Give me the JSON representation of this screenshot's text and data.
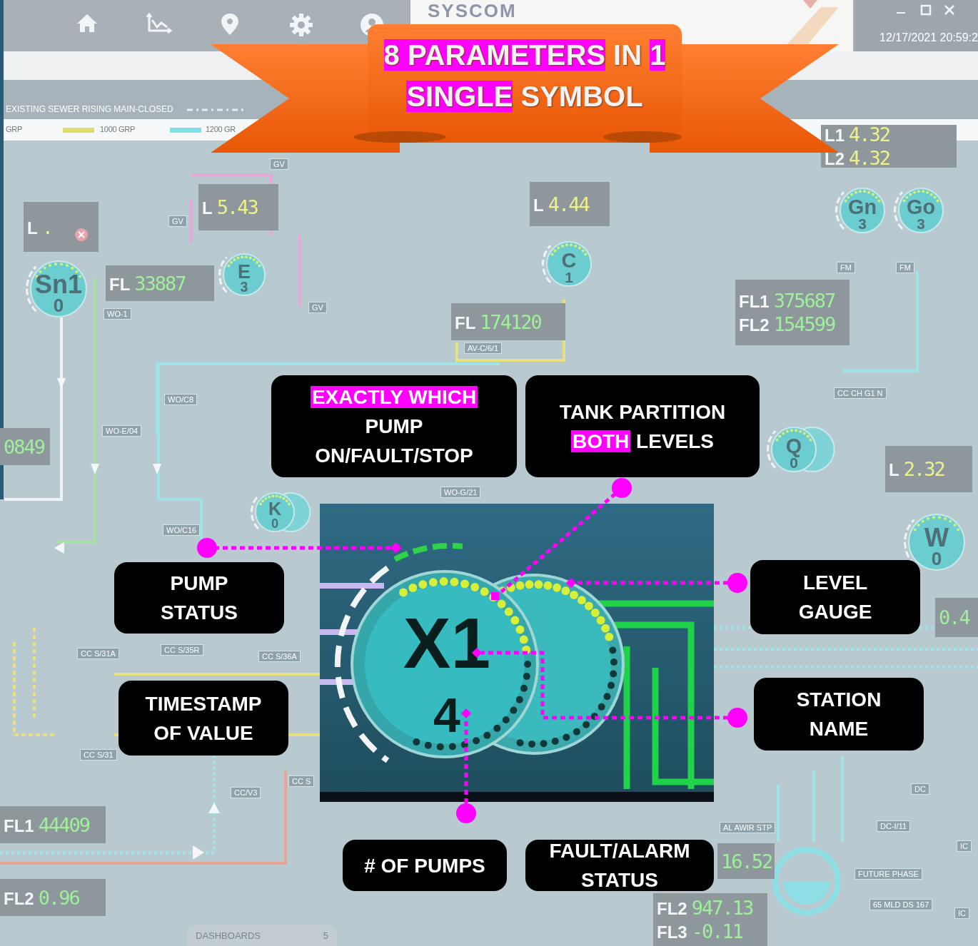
{
  "toolbar": {
    "clock": "12/17/2021 20:59:2"
  },
  "logo": {
    "text": "SYSCOM"
  },
  "legend": {
    "title": "EXISTING SEWER RISING MAIN-CLOSED",
    "items": [
      {
        "label": "GRP"
      },
      {
        "label": "1000 GRP",
        "color": "#e0dc6a"
      },
      {
        "label": "1200 GR",
        "color": "#7fe0e6"
      }
    ]
  },
  "banner": {
    "lines": [
      [
        {
          "text": "8 PARAMETERS",
          "highlight": true
        },
        {
          "text": "IN",
          "highlight": false
        },
        {
          "text": "1",
          "highlight": true
        }
      ],
      [
        {
          "text": "SINGLE",
          "highlight": true
        },
        {
          "text": "SYMBOL",
          "highlight": false
        }
      ]
    ]
  },
  "displays": [
    {
      "kind": "alarm",
      "readings": [
        {
          "label": "L",
          "value": "."
        }
      ]
    },
    {
      "kind": "level",
      "readings": [
        {
          "label": "L",
          "value": "5.43"
        }
      ]
    },
    {
      "kind": "level",
      "readings": [
        {
          "label": "L",
          "value": "4.44"
        }
      ]
    },
    {
      "kind": "level",
      "readings": [
        {
          "label": "L1",
          "value": "4.32"
        },
        {
          "label": "L2",
          "value": "4.32"
        }
      ]
    },
    {
      "kind": "level",
      "readings": [
        {
          "label": "L",
          "value": "2.32"
        }
      ]
    },
    {
      "kind": "flow",
      "readings": [
        {
          "label": "FL",
          "value": "33887"
        }
      ]
    },
    {
      "kind": "flow",
      "readings": [
        {
          "label": "FL",
          "value": "174120"
        }
      ]
    },
    {
      "kind": "flow",
      "readings": [
        {
          "label": "FL1",
          "value": "375687"
        },
        {
          "label": "FL2",
          "value": "154599"
        }
      ]
    },
    {
      "kind": "flow",
      "readings": [
        {
          "value": "0849"
        }
      ]
    },
    {
      "kind": "flow",
      "readings": [
        {
          "label": "FL1",
          "value": "44409"
        }
      ]
    },
    {
      "kind": "flow",
      "readings": [
        {
          "label": "FL2",
          "value": "0.96"
        }
      ]
    },
    {
      "kind": "flow",
      "readings": [
        {
          "value": "0.4"
        }
      ]
    },
    {
      "kind": "flow",
      "readings": [
        {
          "value": "16.52"
        }
      ]
    },
    {
      "kind": "flow",
      "readings": [
        {
          "label": "FL2",
          "value": "947.13"
        },
        {
          "label": "FL3",
          "value": "-0.11"
        }
      ]
    }
  ],
  "pumps": [
    {
      "name": "Sn1",
      "count": "0",
      "kind": "single"
    },
    {
      "name": "E",
      "count": "3",
      "kind": "single"
    },
    {
      "name": "C",
      "count": "1",
      "kind": "single"
    },
    {
      "name": "Gn",
      "count": "3",
      "kind": "single"
    },
    {
      "name": "Go",
      "count": "3",
      "kind": "single"
    },
    {
      "name": "K",
      "count": "0",
      "kind": "twin"
    },
    {
      "name": "Q",
      "count": "0",
      "kind": "twin"
    },
    {
      "name": "W",
      "count": "0",
      "kind": "single"
    }
  ],
  "tags": [
    "GV",
    "GV",
    "FM",
    "FM",
    "GV",
    "WO-1",
    "AV-C/6/1",
    "CC CH G1 N",
    "WO/C8",
    "WO-E/04",
    "WO-G/21",
    "WO/C16",
    "CC S/35R",
    "CC S/31A",
    "CC S/36A",
    "CC S/31",
    "CC S",
    "DC",
    "CC/V3",
    "DC-I/11",
    "AL AWIR STP",
    "IC",
    "FUTURE PHASE",
    "65 MLD DS 167",
    "IC"
  ],
  "dashboards": {
    "label": "DASHBOARDS",
    "count": "5"
  },
  "inset": {
    "name": "X1",
    "count": "4"
  },
  "callouts": [
    {
      "lines": [
        [
          {
            "text": "EXACTLY WHICH",
            "highlight": true
          }
        ],
        [
          {
            "text": "PUMP",
            "highlight": false
          }
        ],
        [
          {
            "text": "ON/FAULT/STOP",
            "highlight": false
          }
        ]
      ]
    },
    {
      "lines": [
        [
          {
            "text": "TANK PARTITION",
            "highlight": false
          }
        ],
        [
          {
            "text": "BOTH",
            "highlight": true
          },
          {
            "text": "LEVELS",
            "highlight": false
          }
        ]
      ]
    },
    {
      "lines": [
        [
          {
            "text": "PUMP",
            "highlight": false
          }
        ],
        [
          {
            "text": "STATUS",
            "highlight": false
          }
        ]
      ]
    },
    {
      "lines": [
        [
          {
            "text": "LEVEL",
            "highlight": false
          }
        ],
        [
          {
            "text": "GAUGE",
            "highlight": false
          }
        ]
      ]
    },
    {
      "lines": [
        [
          {
            "text": "TIMESTAMP",
            "highlight": false
          }
        ],
        [
          {
            "text": "OF VALUE",
            "highlight": false
          }
        ]
      ]
    },
    {
      "lines": [
        [
          {
            "text": "STATION",
            "highlight": false
          }
        ],
        [
          {
            "text": "NAME",
            "highlight": false
          }
        ]
      ]
    },
    {
      "lines": [
        [
          {
            "text": "# OF PUMPS",
            "highlight": false
          }
        ]
      ]
    },
    {
      "lines": [
        [
          {
            "text": "FAULT/ALARM",
            "highlight": false
          }
        ],
        [
          {
            "text": "STATUS",
            "highlight": false
          }
        ]
      ]
    }
  ]
}
